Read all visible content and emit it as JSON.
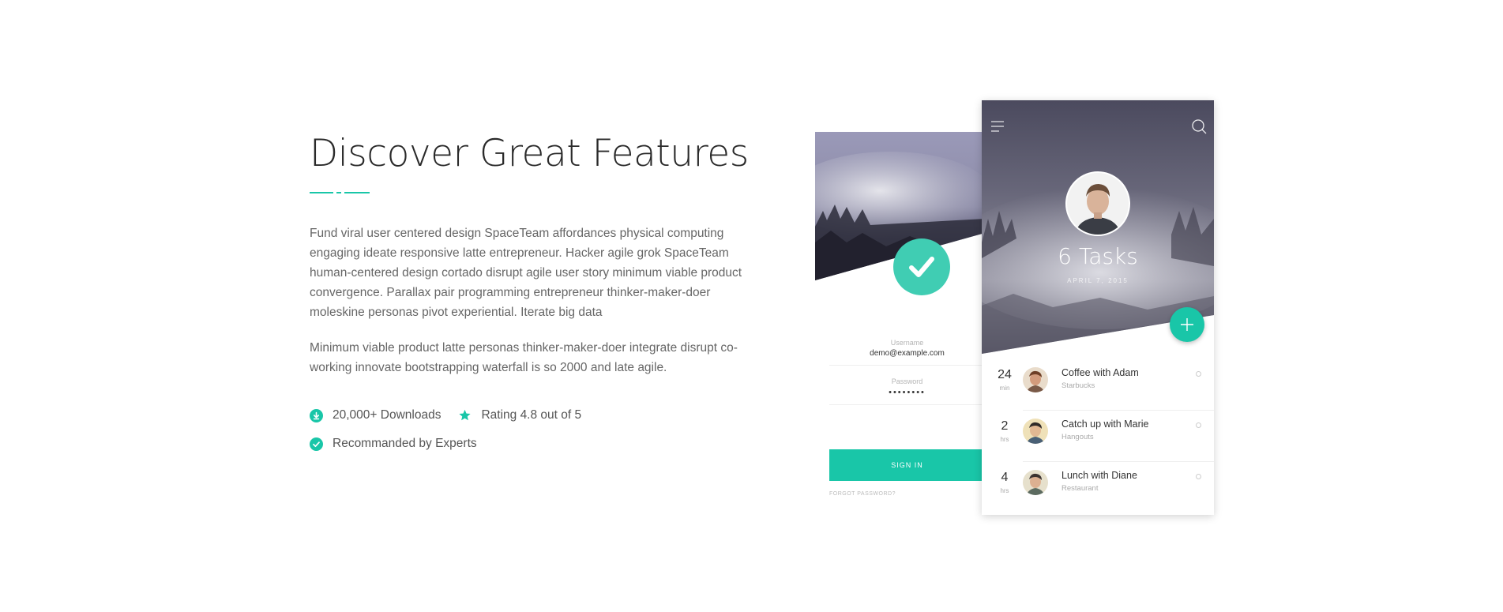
{
  "heading": "Discover Great Features",
  "paragraphs": [
    "Fund viral user centered design SpaceTeam affordances physical computing engaging ideate responsive latte entrepreneur. Hacker agile grok SpaceTeam human-centered design cortado disrupt agile user story minimum viable product convergence. Parallax pair programming entrepreneur thinker-maker-doer moleskine personas pivot experiential. Iterate big data",
    "Minimum viable product latte personas thinker-maker-doer integrate disrupt co-working innovate bootstrapping waterfall is so 2000 and late agile."
  ],
  "features": [
    {
      "label": "20,000+ Downloads",
      "icon": "download-icon"
    },
    {
      "label": "Rating 4.8 out of 5",
      "icon": "star-icon"
    },
    {
      "label": "Recommanded by Experts",
      "icon": "check-circle-icon"
    }
  ],
  "login_mockup": {
    "username_label": "Username",
    "username_value": "demo@example.com",
    "password_label": "Password",
    "password_value": "••••••••",
    "signin_label": "SIGN IN",
    "forgot_label": "FORGOT PASSWORD?"
  },
  "tasks_mockup": {
    "title": "6 Tasks",
    "date": "APRIL 7, 2015",
    "items": [
      {
        "num": "24",
        "unit": "min",
        "name": "Coffee with Adam",
        "place": "Starbucks"
      },
      {
        "num": "2",
        "unit": "hrs",
        "name": "Catch up with Marie",
        "place": "Hangouts"
      },
      {
        "num": "4",
        "unit": "hrs",
        "name": "Lunch with Diane",
        "place": "Restaurant"
      }
    ]
  },
  "colors": {
    "accent": "#19c6a8",
    "check_circle": "#40cdb3",
    "heading": "#2a2a2a",
    "body_text": "#666666"
  }
}
